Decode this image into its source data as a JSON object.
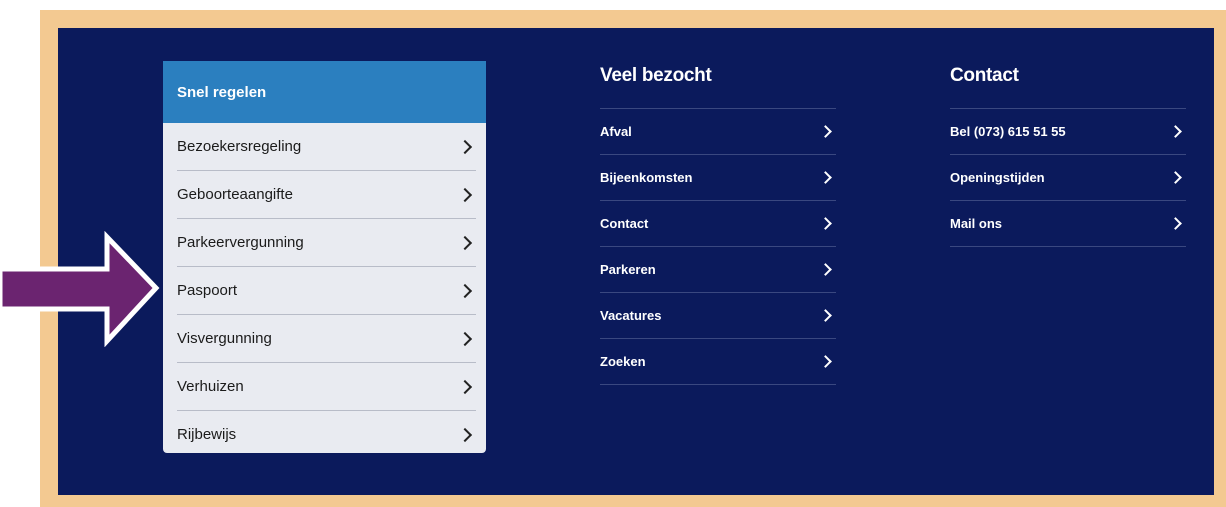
{
  "quick": {
    "title": "Snel regelen",
    "items": [
      {
        "label": "Bezoekersregeling"
      },
      {
        "label": "Geboorteaangifte"
      },
      {
        "label": "Parkeervergunning"
      },
      {
        "label": "Paspoort"
      },
      {
        "label": "Visvergunning"
      },
      {
        "label": "Verhuizen"
      },
      {
        "label": "Rijbewijs"
      }
    ]
  },
  "visited": {
    "title": "Veel bezocht",
    "items": [
      {
        "label": "Afval"
      },
      {
        "label": "Bijeenkomsten"
      },
      {
        "label": "Contact"
      },
      {
        "label": "Parkeren"
      },
      {
        "label": "Vacatures"
      },
      {
        "label": "Zoeken"
      }
    ]
  },
  "contact": {
    "title": "Contact",
    "items": [
      {
        "label": "Bel (073) 615 51 55"
      },
      {
        "label": "Openingstijden"
      },
      {
        "label": "Mail ons"
      }
    ]
  },
  "colors": {
    "frame": "#f3c991",
    "panel": "#0b1a5c",
    "quick_header": "#2b7fbf",
    "arrow": "#6b2470"
  }
}
